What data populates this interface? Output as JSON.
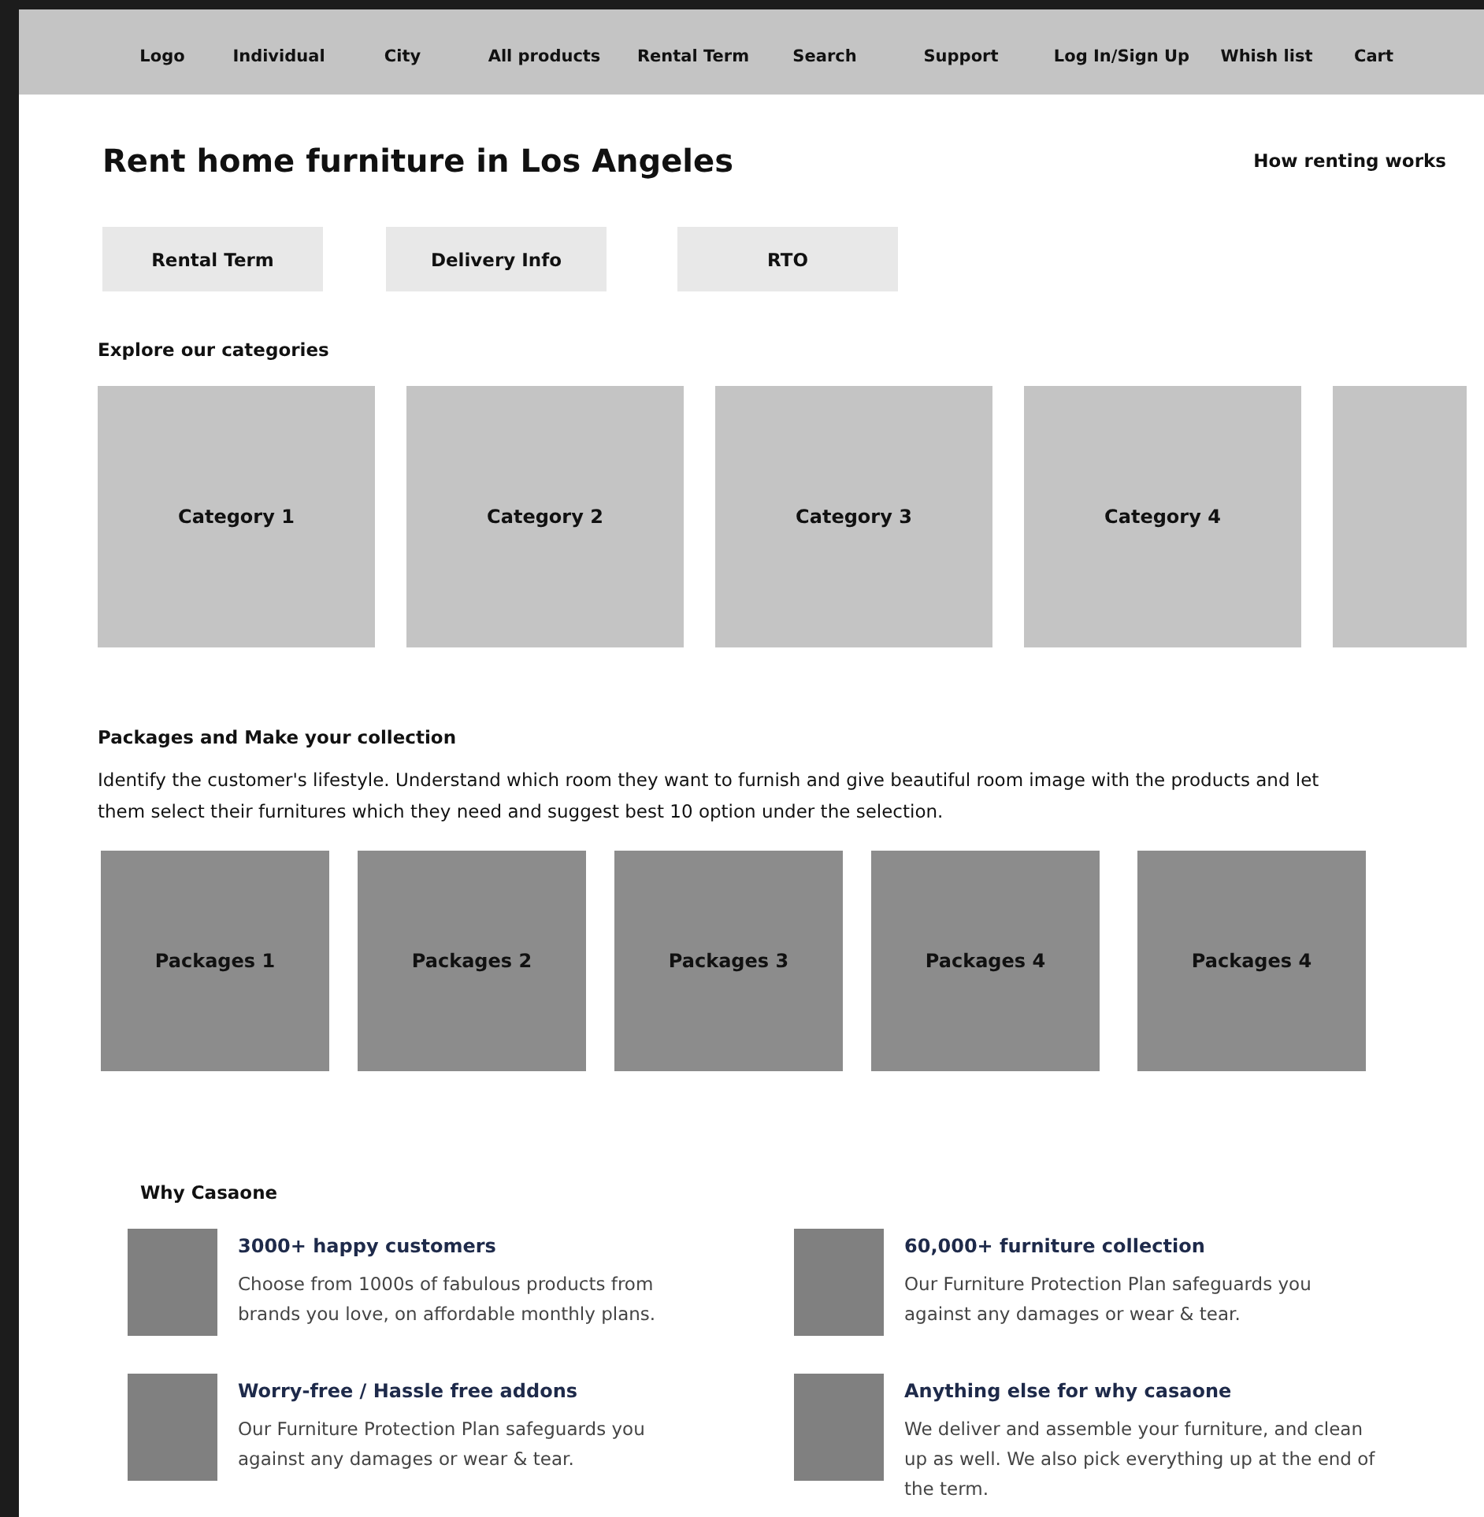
{
  "nav": {
    "items": [
      "Logo",
      "Individual",
      "City",
      "All products",
      "Rental Term",
      "Search",
      "Support",
      "Log In/Sign Up",
      "Whish list",
      "Cart"
    ]
  },
  "header": {
    "title": "Rent home furniture in Los Angeles",
    "link": "How renting works"
  },
  "tabs": [
    "Rental Term",
    "Delivery Info",
    "RTO"
  ],
  "categories": {
    "heading": "Explore our categories",
    "items": [
      {
        "kind": "tile",
        "label": "Category 1"
      },
      {
        "kind": "tile",
        "label": "Category 2"
      },
      {
        "kind": "tile",
        "label": "Category 3"
      },
      {
        "kind": "tile",
        "label": "Category 4"
      },
      {
        "kind": "partial"
      }
    ]
  },
  "packages": {
    "heading": "Packages and Make your collection",
    "description": "Identify the customer's lifestyle. Understand which room they want to furnish and give beautiful room image with the products and let them select their furnitures which they need and suggest best 10 option under the selection.",
    "items": [
      "Packages 1",
      "Packages 2",
      "Packages 3",
      "Packages 4",
      "Packages 4"
    ]
  },
  "why": {
    "heading": "Why Casaone",
    "features": [
      {
        "title": "3000+ happy customers",
        "text": "Choose from 1000s of fabulous products from brands you love, on affordable monthly plans."
      },
      {
        "title": "60,000+ furniture collection",
        "text": "Our Furniture Protection Plan safeguards you against any damages or wear & tear."
      },
      {
        "title": "Worry-free / Hassle free addons",
        "text": "Our Furniture Protection Plan safeguards you against any damages or wear & tear."
      },
      {
        "title": "Anything else for why casaone",
        "text": "We deliver and assemble your furniture, and clean up as well. We also pick everything up at the end of the term."
      }
    ]
  }
}
